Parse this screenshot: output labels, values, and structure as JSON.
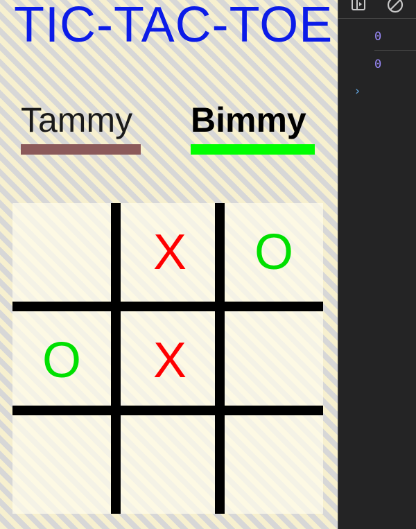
{
  "game": {
    "title": "TIC-TAC-TOE",
    "players": [
      {
        "name": "Tammy",
        "color": "#8c5a5a",
        "active": false
      },
      {
        "name": "Bimmy",
        "color": "#00ff00",
        "active": true
      }
    ],
    "board": {
      "cells": [
        "",
        "X",
        "O",
        "O",
        "X",
        "",
        "",
        "",
        ""
      ]
    },
    "mark_colors": {
      "X": "#ff0000",
      "O": "#00e000"
    }
  },
  "devtools": {
    "console_values": [
      "0",
      "0"
    ],
    "prompt": "›",
    "icons": [
      "show-console-sidebar-icon",
      "clear-console-icon"
    ]
  }
}
